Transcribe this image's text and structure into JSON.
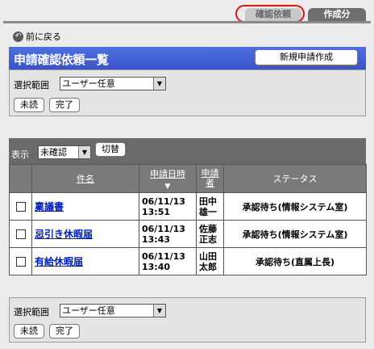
{
  "tabs": {
    "confirm": "確認依頼",
    "create": "作成分"
  },
  "nav": {
    "back": "前に戻る"
  },
  "header": {
    "title": "申請確認依頼一覧",
    "new_button": "新規申請作成"
  },
  "filter": {
    "scope_label": "選択範囲",
    "scope_value": "ユーザー任意",
    "unread_button": "未読",
    "done_button": "完了"
  },
  "display": {
    "label": "表示",
    "value": "未確認",
    "switch_button": "切替"
  },
  "table": {
    "columns": {
      "name": "件名",
      "date": "申請日時",
      "applicant": "申請者",
      "status": "ステータス"
    },
    "rows": [
      {
        "name": "稟議書",
        "date": "06/11/13",
        "time": "13:51",
        "applicant1": "田中",
        "applicant2": "雄一",
        "status": "承認待ち(情報システム室)"
      },
      {
        "name": "忌引き休暇届",
        "date": "06/11/13",
        "time": "13:43",
        "applicant1": "佐藤",
        "applicant2": "正志",
        "status": "承認待ち(情報システム室)"
      },
      {
        "name": "有給休暇届",
        "date": "06/11/13",
        "time": "13:40",
        "applicant1": "山田",
        "applicant2": "太郎",
        "status": "承認待ち(直属上長)"
      }
    ]
  },
  "colors": {
    "header": "#3a53cc",
    "highlight": "#e0101b",
    "link": "#0022bb"
  }
}
